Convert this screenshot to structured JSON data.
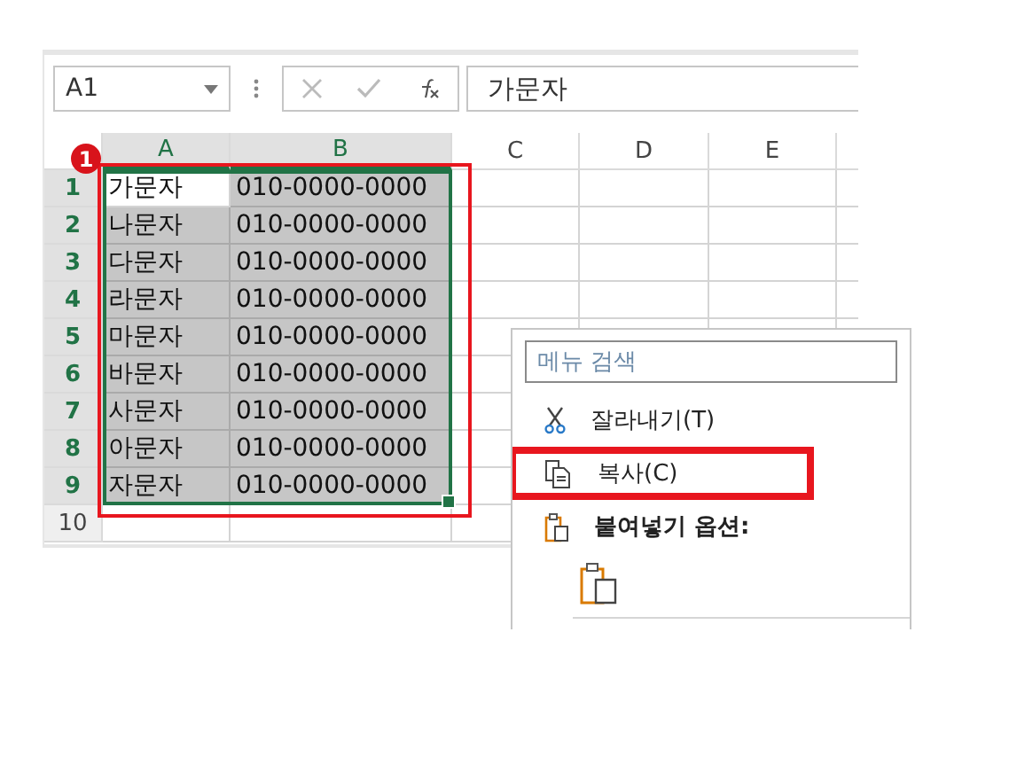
{
  "name_box": "A1",
  "formula_bar": {
    "value": "가문자"
  },
  "columns": [
    {
      "label": "A",
      "selected": true
    },
    {
      "label": "B",
      "selected": true
    },
    {
      "label": "C",
      "selected": false
    },
    {
      "label": "D",
      "selected": false
    },
    {
      "label": "E",
      "selected": false
    }
  ],
  "rows": [
    {
      "number": "1",
      "selected": true,
      "cells": [
        "가문자",
        "010-0000-0000"
      ]
    },
    {
      "number": "2",
      "selected": true,
      "cells": [
        "나문자",
        "010-0000-0000"
      ]
    },
    {
      "number": "3",
      "selected": true,
      "cells": [
        "다문자",
        "010-0000-0000"
      ]
    },
    {
      "number": "4",
      "selected": true,
      "cells": [
        "라문자",
        "010-0000-0000"
      ]
    },
    {
      "number": "5",
      "selected": true,
      "cells": [
        "마문자",
        "010-0000-0000"
      ]
    },
    {
      "number": "6",
      "selected": true,
      "cells": [
        "바문자",
        "010-0000-0000"
      ]
    },
    {
      "number": "7",
      "selected": true,
      "cells": [
        "사문자",
        "010-0000-0000"
      ]
    },
    {
      "number": "8",
      "selected": true,
      "cells": [
        "아문자",
        "010-0000-0000"
      ]
    },
    {
      "number": "9",
      "selected": true,
      "cells": [
        "자문자",
        "010-0000-0000"
      ]
    },
    {
      "number": "10",
      "selected": false,
      "cells": [
        "",
        ""
      ]
    }
  ],
  "step_badge": "1",
  "context_menu": {
    "search": {
      "placeholder": "메뉴 검색"
    },
    "items": [
      {
        "kind": "cut",
        "label": "잘라내기(T)",
        "highlighted": false
      },
      {
        "kind": "copy",
        "label": "복사(C)",
        "highlighted": true
      },
      {
        "kind": "heading",
        "label": "붙여넣기 옵션:",
        "highlighted": false
      },
      {
        "kind": "paste-option"
      }
    ]
  }
}
